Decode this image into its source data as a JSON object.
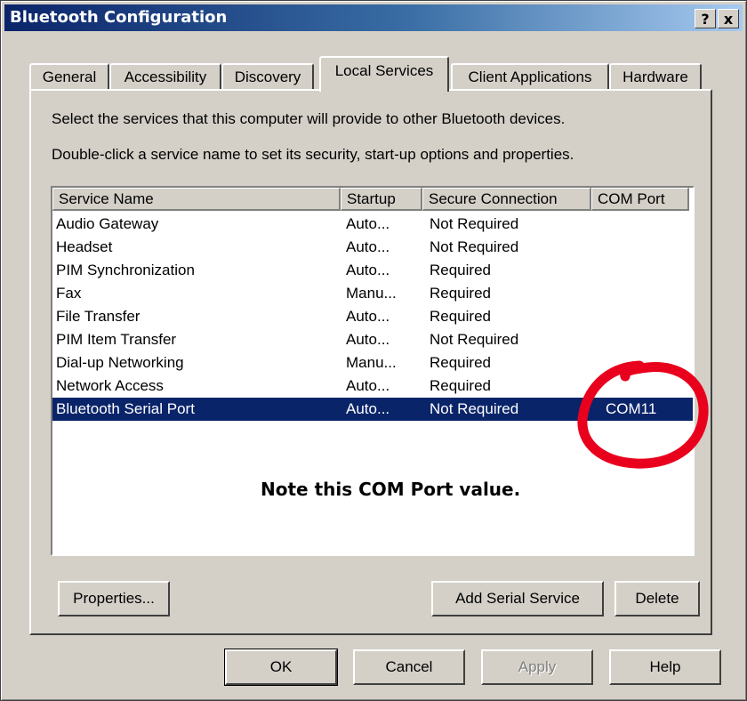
{
  "window": {
    "title": "Bluetooth Configuration",
    "help_button": "?",
    "close_button": "x"
  },
  "tabs": [
    {
      "label": "General"
    },
    {
      "label": "Accessibility"
    },
    {
      "label": "Discovery"
    },
    {
      "label": "Local Services",
      "active": true
    },
    {
      "label": "Client Applications"
    },
    {
      "label": "Hardware"
    }
  ],
  "panel": {
    "instruction1": "Select the services that this computer will provide to other Bluetooth devices.",
    "instruction2": "Double-click a service name to set its security, start-up options and properties."
  },
  "services_table": {
    "columns": [
      "Service Name",
      "Startup",
      "Secure Connection",
      "COM Port"
    ],
    "rows": [
      {
        "name": "Audio Gateway",
        "startup": "Auto...",
        "secure": "Not Required",
        "com": ""
      },
      {
        "name": "Headset",
        "startup": "Auto...",
        "secure": "Not Required",
        "com": ""
      },
      {
        "name": "PIM Synchronization",
        "startup": "Auto...",
        "secure": "Required",
        "com": ""
      },
      {
        "name": "Fax",
        "startup": "Manu...",
        "secure": "Required",
        "com": ""
      },
      {
        "name": "File Transfer",
        "startup": "Auto...",
        "secure": "Required",
        "com": ""
      },
      {
        "name": "PIM Item Transfer",
        "startup": "Auto...",
        "secure": "Not Required",
        "com": ""
      },
      {
        "name": "Dial-up Networking",
        "startup": "Manu...",
        "secure": "Required",
        "com": ""
      },
      {
        "name": "Network Access",
        "startup": "Auto...",
        "secure": "Required",
        "com": ""
      },
      {
        "name": "Bluetooth Serial Port",
        "startup": "Auto...",
        "secure": "Not Required",
        "com": "COM11",
        "selected": true
      }
    ]
  },
  "annotation": {
    "note": "Note this COM Port value.",
    "circle_color": "#e8001c"
  },
  "panel_buttons": {
    "properties": "Properties...",
    "add_serial": "Add Serial Service",
    "delete": "Delete"
  },
  "dialog_buttons": {
    "ok": "OK",
    "cancel": "Cancel",
    "apply": "Apply",
    "help": "Help"
  },
  "colors": {
    "titlebar": "#0a246a",
    "selection": "#0a246a",
    "face": "#d4d0c8"
  }
}
